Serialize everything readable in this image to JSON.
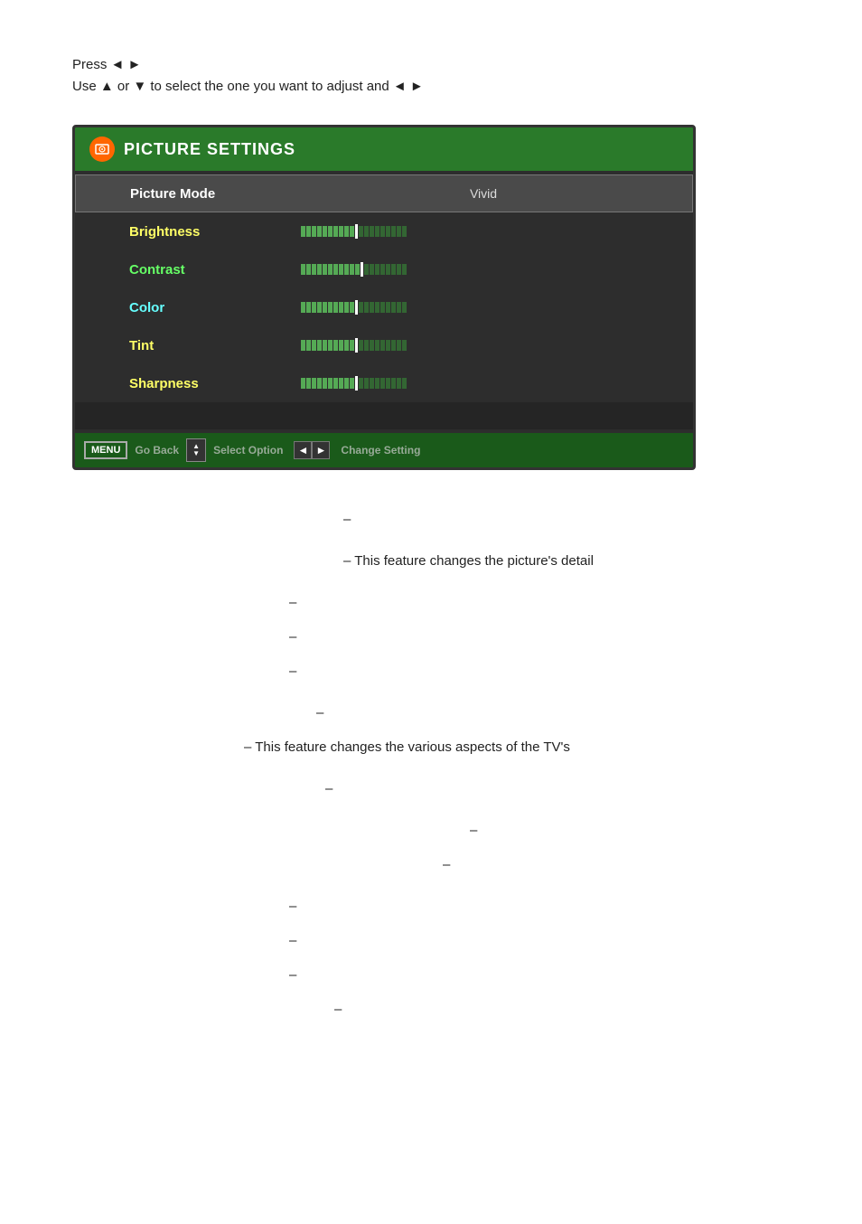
{
  "instructions": {
    "line1_prefix": "Press",
    "line1_left_arrow": "◄",
    "line1_right_arrow": "►",
    "line2": "Use ▲ or ▼ to select the one you want to adjust and ◄",
    "line2_end_arrow": "►"
  },
  "tv": {
    "header": {
      "title": "PICTURE SETTINGS",
      "icon_label": "🔊"
    },
    "menu_items": [
      {
        "label": "Picture Mode",
        "value": "Vivid",
        "type": "value",
        "color": "white"
      },
      {
        "label": "Brightness",
        "type": "bar",
        "color": "yellow"
      },
      {
        "label": "Contrast",
        "type": "bar",
        "color": "green"
      },
      {
        "label": "Color",
        "type": "bar",
        "color": "cyan"
      },
      {
        "label": "Tint",
        "type": "bar",
        "color": "yellow"
      },
      {
        "label": "Sharpness",
        "type": "bar",
        "color": "yellow"
      }
    ],
    "statusbar": {
      "menu_label": "MENU",
      "go_back": "Go Back",
      "select_option": "Select Option",
      "change_setting": "Change Setting"
    }
  },
  "body_content": {
    "dashes": [
      {
        "text": "–",
        "indent": 380
      },
      {
        "text": "– This feature changes the picture's detail",
        "indent": 380
      },
      {
        "text": "–",
        "indent": 310
      },
      {
        "text": "–",
        "indent": 310
      },
      {
        "text": "–",
        "indent": 310
      },
      {
        "text": "–",
        "indent": 340
      },
      {
        "text": "– This feature changes the various aspects of the TV's",
        "indent": 340
      },
      {
        "text": "–",
        "indent": 360
      },
      {
        "text": "–",
        "indent": 530
      },
      {
        "text": "–",
        "indent": 500
      },
      {
        "text": "–",
        "indent": 310
      },
      {
        "text": "–",
        "indent": 310
      },
      {
        "text": "–",
        "indent": 310
      },
      {
        "text": "–",
        "indent": 360
      }
    ]
  }
}
